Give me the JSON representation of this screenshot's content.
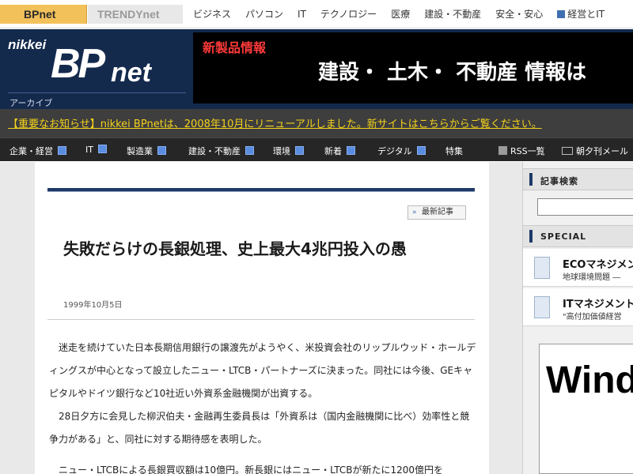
{
  "topbar": {
    "tab_bpnet": "BPnet",
    "tab_trendy": "TRENDYnet",
    "nav": [
      "ビジネス",
      "パソコン",
      "IT",
      "テクノロジー",
      "医療",
      "建設・不動産",
      "安全・安心",
      "経営とIT"
    ]
  },
  "header": {
    "logo_small": "nikkei",
    "logo_big": "BP",
    "logo_net": "net",
    "archive_label": "アーカイブ",
    "banner_sub": "新製品情報",
    "banner_main": "建設・ 土木・ 不動産  情報は"
  },
  "notice": {
    "text": "【重要なお知らせ】nikkei BPnetは、2008年10月にリニューアルしました。新サイトはこちらからご覧ください。"
  },
  "catnav": {
    "items": [
      "企業・経営",
      "IT",
      "製造業",
      "建設・不動産",
      "環境",
      "新着",
      "デジタル",
      "特集"
    ],
    "rss_list": "RSS一覧",
    "mail": "朝夕刊メール"
  },
  "article": {
    "latest_button": "最新記事",
    "title": "失敗だらけの長銀処理、史上最大4兆円投入の愚",
    "date": "1999年10月5日",
    "paragraphs": [
      "　迷走を続けていた日本長期信用銀行の譲渡先がようやく、米投資会社のリップルウッド・ホールディングスが中心となって設立したニュー・LTCB・パートナーズに決まった。同社には今後、GEキャピタルやドイツ銀行など10社近い外資系金融機関が出資する。",
      "　28日夕方に会見した柳沢伯夫・金融再生委員長は「外資系は（国内金融機関に比べ）効率性と競争力がある」と、同社に対する期待感を表明した。",
      "　ニュー・LTCBによる長銀買収額は10億円。新長銀にはニュー・LTCBが新たに1200億円を"
    ]
  },
  "sidebar": {
    "search_heading": "記事検索",
    "search_value": "",
    "special_heading": "SPECIAL",
    "specials": [
      {
        "title": "ECOマネジメント",
        "sub": "地球環境問題 ―"
      },
      {
        "title": "ITマネジメント",
        "sub": "\"高付加価値経営"
      }
    ],
    "ad_text": "Windo"
  }
}
